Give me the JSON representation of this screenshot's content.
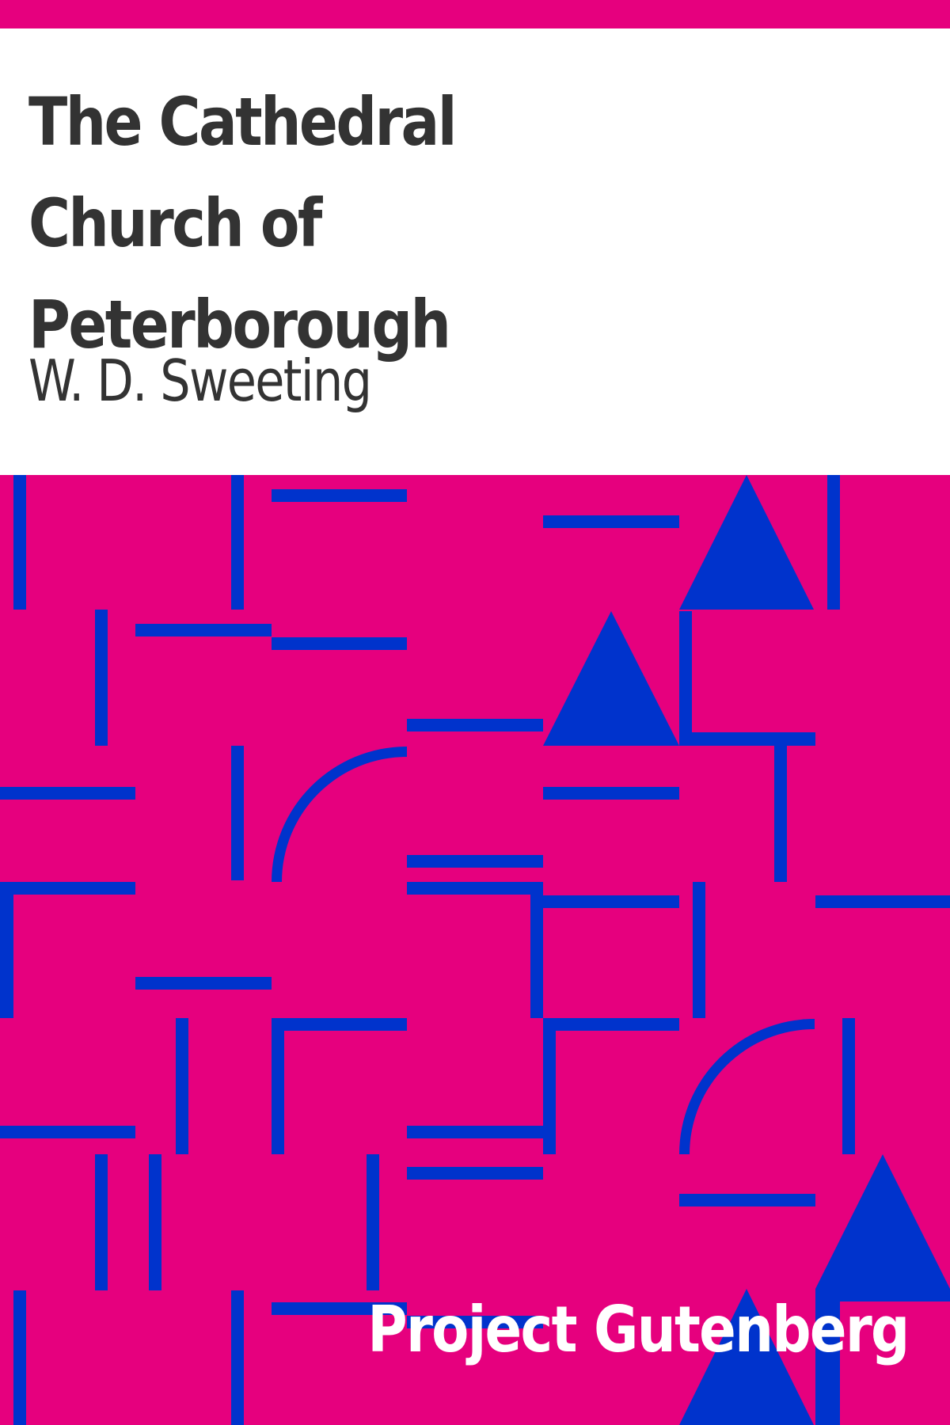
{
  "cover": {
    "title": "The Cathedral Church of Peterborough",
    "author": "W. D. Sweeting",
    "publisher": "Project Gutenberg"
  },
  "colors": {
    "background": "#E6007E",
    "shapes": "#0033CC",
    "title_text": "#333333",
    "publisher_text": "#FFFFFF",
    "title_block": "#FFFFFF"
  },
  "pattern_shapes": [
    "horizontal-bar",
    "vertical-bar",
    "corner-bracket",
    "quarter-arc",
    "triangle"
  ]
}
